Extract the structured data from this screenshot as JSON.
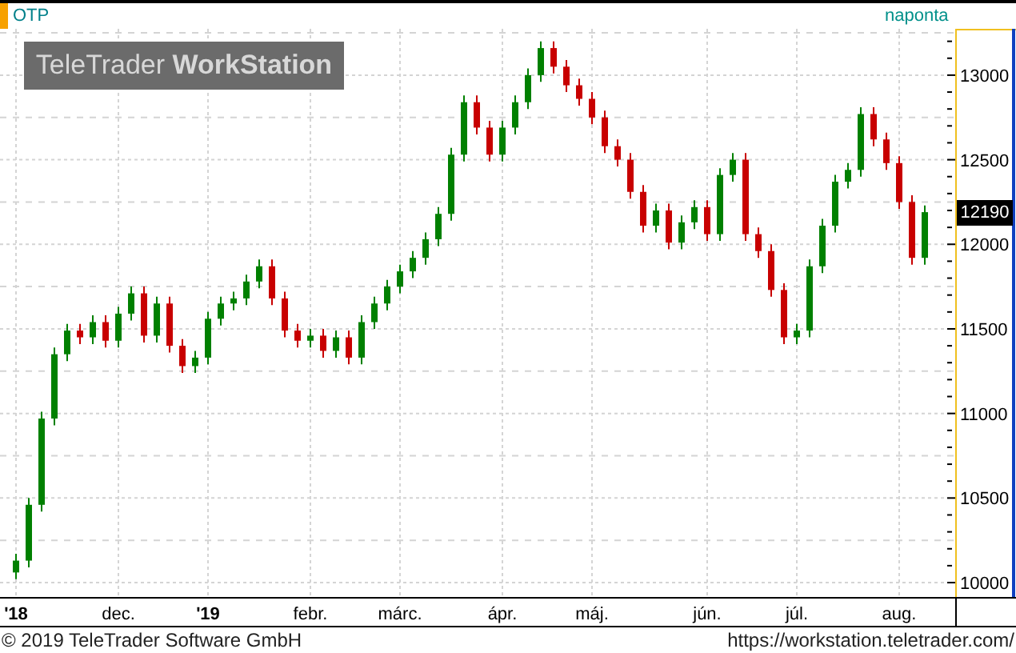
{
  "chart": {
    "interval": "naponta",
    "logo": "TeleTrader **WorkStation**",
    "last_price": "12190",
    "chart_data": {
      "type": "candlestick",
      "title": "OTP",
      "grid": true,
      "ylim": [
        9915,
        13255
      ],
      "yticks": [
        10000,
        10500,
        11000,
        11500,
        12000,
        12500,
        13000
      ],
      "categories": [
        "'18",
        null,
        null,
        null,
        null,
        null,
        null,
        null,
        "dec.",
        null,
        null,
        null,
        null,
        null,
        null,
        "'19",
        null,
        null,
        null,
        null,
        null,
        null,
        null,
        "febr.",
        null,
        null,
        null,
        null,
        null,
        null,
        "márc.",
        null,
        null,
        null,
        null,
        null,
        null,
        null,
        "ápr.",
        null,
        null,
        null,
        null,
        null,
        null,
        "máj.",
        null,
        null,
        null,
        null,
        null,
        null,
        null,
        null,
        "jún.",
        null,
        null,
        null,
        null,
        null,
        null,
        "júl.",
        null,
        null,
        null,
        null,
        null,
        null,
        null,
        "aug.",
        null,
        null
      ],
      "ohlc": [
        [
          10060,
          10170,
          10020,
          10130
        ],
        [
          10130,
          10500,
          10090,
          10460
        ],
        [
          10460,
          11010,
          10420,
          10970
        ],
        [
          10970,
          11390,
          10930,
          11350
        ],
        [
          11350,
          11530,
          11310,
          11490
        ],
        [
          11490,
          11530,
          11410,
          11450
        ],
        [
          11450,
          11580,
          11410,
          11540
        ],
        [
          11540,
          11580,
          11390,
          11430
        ],
        [
          11430,
          11630,
          11390,
          11590
        ],
        [
          11590,
          11750,
          11550,
          11710
        ],
        [
          11710,
          11750,
          11420,
          11460
        ],
        [
          11460,
          11690,
          11420,
          11650
        ],
        [
          11650,
          11690,
          11360,
          11400
        ],
        [
          11400,
          11440,
          11240,
          11280
        ],
        [
          11280,
          11370,
          11240,
          11330
        ],
        [
          11330,
          11600,
          11290,
          11560
        ],
        [
          11560,
          11690,
          11520,
          11650
        ],
        [
          11650,
          11720,
          11610,
          11680
        ],
        [
          11680,
          11820,
          11640,
          11780
        ],
        [
          11780,
          11910,
          11740,
          11870
        ],
        [
          11870,
          11910,
          11640,
          11680
        ],
        [
          11680,
          11720,
          11450,
          11490
        ],
        [
          11490,
          11530,
          11390,
          11430
        ],
        [
          11430,
          11500,
          11390,
          11460
        ],
        [
          11460,
          11500,
          11330,
          11370
        ],
        [
          11370,
          11490,
          11330,
          11450
        ],
        [
          11450,
          11490,
          11290,
          11330
        ],
        [
          11330,
          11580,
          11290,
          11540
        ],
        [
          11540,
          11690,
          11500,
          11650
        ],
        [
          11650,
          11790,
          11610,
          11750
        ],
        [
          11750,
          11880,
          11710,
          11840
        ],
        [
          11840,
          11960,
          11800,
          11920
        ],
        [
          11920,
          12070,
          11880,
          12030
        ],
        [
          12030,
          12220,
          11990,
          12180
        ],
        [
          12180,
          12570,
          12140,
          12530
        ],
        [
          12530,
          12880,
          12490,
          12840
        ],
        [
          12840,
          12880,
          12650,
          12690
        ],
        [
          12690,
          12730,
          12490,
          12530
        ],
        [
          12530,
          12730,
          12490,
          12690
        ],
        [
          12690,
          12880,
          12650,
          12840
        ],
        [
          12840,
          13040,
          12800,
          13000
        ],
        [
          13000,
          13200,
          12960,
          13160
        ],
        [
          13160,
          13200,
          13010,
          13050
        ],
        [
          13050,
          13090,
          12900,
          12940
        ],
        [
          12940,
          12980,
          12820,
          12860
        ],
        [
          12860,
          12900,
          12710,
          12750
        ],
        [
          12750,
          12790,
          12540,
          12580
        ],
        [
          12580,
          12620,
          12460,
          12500
        ],
        [
          12500,
          12540,
          12270,
          12310
        ],
        [
          12310,
          12350,
          12070,
          12110
        ],
        [
          12110,
          12240,
          12070,
          12200
        ],
        [
          12200,
          12240,
          11970,
          12010
        ],
        [
          12010,
          12170,
          11970,
          12130
        ],
        [
          12130,
          12260,
          12090,
          12220
        ],
        [
          12220,
          12260,
          12020,
          12060
        ],
        [
          12060,
          12450,
          12020,
          12410
        ],
        [
          12410,
          12540,
          12370,
          12500
        ],
        [
          12500,
          12540,
          12020,
          12060
        ],
        [
          12060,
          12100,
          11920,
          11960
        ],
        [
          11960,
          12000,
          11690,
          11730
        ],
        [
          11730,
          11770,
          11410,
          11450
        ],
        [
          11450,
          11530,
          11410,
          11490
        ],
        [
          11490,
          11910,
          11450,
          11870
        ],
        [
          11870,
          12150,
          11830,
          12110
        ],
        [
          12110,
          12410,
          12070,
          12370
        ],
        [
          12370,
          12480,
          12330,
          12440
        ],
        [
          12440,
          12810,
          12400,
          12770
        ],
        [
          12770,
          12810,
          12580,
          12620
        ],
        [
          12620,
          12660,
          12440,
          12480
        ],
        [
          12480,
          12520,
          12210,
          12250
        ],
        [
          12250,
          12290,
          11880,
          11920
        ],
        [
          11920,
          12230,
          11880,
          12190
        ]
      ]
    }
  },
  "footer": {
    "copyright": "© 2019 TeleTrader Software GmbH",
    "url": "https://workstation.teletrader.com/"
  }
}
